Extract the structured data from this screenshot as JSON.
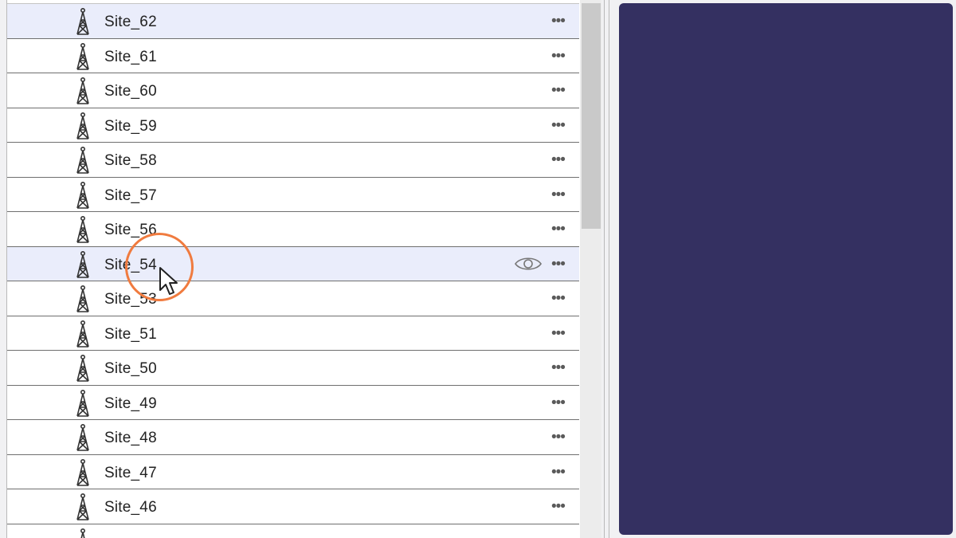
{
  "tree": {
    "rows": [
      {
        "label": "Site_62",
        "icon": "tower-icon",
        "action": "more-icon",
        "highlighted": true
      },
      {
        "label": "Site_61",
        "icon": "tower-icon",
        "action": "more-icon"
      },
      {
        "label": "Site_60",
        "icon": "tower-icon",
        "action": "more-icon"
      },
      {
        "label": "Site_59",
        "icon": "tower-icon",
        "action": "more-icon"
      },
      {
        "label": "Site_58",
        "icon": "tower-icon",
        "action": "more-icon"
      },
      {
        "label": "Site_57",
        "icon": "tower-icon",
        "action": "more-icon"
      },
      {
        "label": "Site_56",
        "icon": "tower-icon",
        "action": "more-icon"
      },
      {
        "label": "Site_54",
        "icon": "tower-icon",
        "action": "more-icon",
        "highlighted": true,
        "visibility_icon": "eye-icon"
      },
      {
        "label": "Site_53",
        "icon": "tower-icon",
        "action": "more-icon"
      },
      {
        "label": "Site_51",
        "icon": "tower-icon",
        "action": "more-icon"
      },
      {
        "label": "Site_50",
        "icon": "tower-icon",
        "action": "more-icon"
      },
      {
        "label": "Site_49",
        "icon": "tower-icon",
        "action": "more-icon"
      },
      {
        "label": "Site_48",
        "icon": "tower-icon",
        "action": "more-icon"
      },
      {
        "label": "Site_47",
        "icon": "tower-icon",
        "action": "more-icon"
      },
      {
        "label": "Site_46",
        "icon": "tower-icon",
        "action": "more-icon"
      },
      {
        "label": "",
        "icon": "tower-icon",
        "action": "",
        "partial": true
      }
    ],
    "more_glyph": "•••"
  },
  "colors": {
    "highlight_row": "#eaedfb",
    "dark_panel": "#343061",
    "cursor_ring": "#f07b3f"
  }
}
